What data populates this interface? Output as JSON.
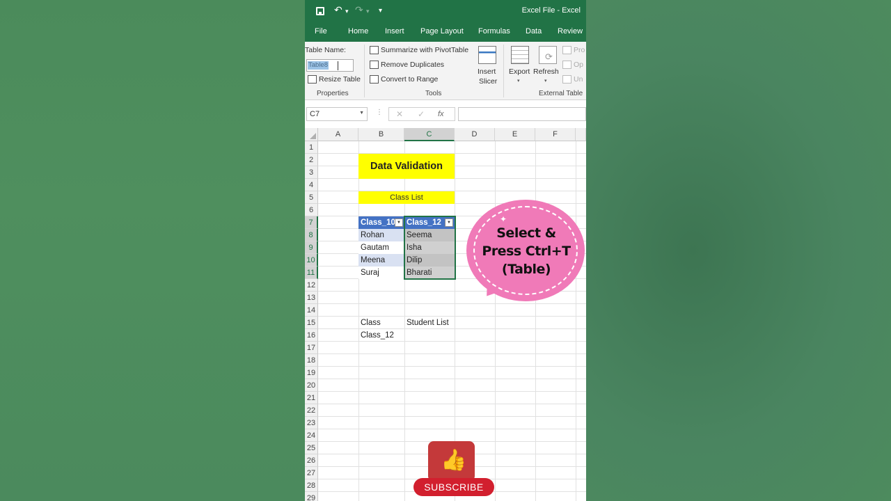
{
  "window": {
    "title": "Excel File  -  Excel"
  },
  "tabs": [
    "File",
    "Home",
    "Insert",
    "Page Layout",
    "Formulas",
    "Data",
    "Review"
  ],
  "ribbon": {
    "table_name_label": "Table Name:",
    "table_name_value": "Table8",
    "resize_table": "Resize Table",
    "properties_group": "Properties",
    "summarize_pivot": "Summarize with PivotTable",
    "remove_duplicates": "Remove Duplicates",
    "convert_to_range": "Convert to Range",
    "tools_group": "Tools",
    "insert_slicer_line1": "Insert",
    "insert_slicer_line2": "Slicer",
    "export": "Export",
    "refresh": "Refresh",
    "properties_trunc": "Pro",
    "open_trunc": "Op",
    "unlink_trunc": "Un",
    "external_group": "External Table"
  },
  "formula_bar": {
    "name_box": "C7",
    "fx": "fx",
    "cancel": "✕",
    "enter": "✓",
    "value": ""
  },
  "sheet": {
    "columns": [
      "A",
      "B",
      "C",
      "D",
      "E",
      "F"
    ],
    "selected_column": "C",
    "rows": [
      "1",
      "2",
      "3",
      "4",
      "5",
      "6",
      "7",
      "8",
      "9",
      "10",
      "11",
      "12",
      "13",
      "14",
      "15",
      "16",
      "17",
      "18",
      "19",
      "20",
      "21",
      "22",
      "23",
      "24",
      "25",
      "26",
      "27",
      "28",
      "29"
    ],
    "selected_rows": [
      "7",
      "8",
      "9",
      "10",
      "11"
    ],
    "title": "Data Validation",
    "subtitle": "Class List",
    "table": {
      "headers": [
        "Class_10",
        "Class_12"
      ],
      "class_10": [
        "Rohan",
        "Gautam",
        "Meena",
        "Suraj"
      ],
      "class_12": [
        "Seema",
        "Isha",
        "Dilip",
        "Bharati"
      ]
    },
    "b15": "Class",
    "c15": "Student List",
    "b16": "Class_12"
  },
  "callout": {
    "line1": "Select &",
    "line2": "Press Ctrl+T",
    "line3": "(Table)",
    "color": "#f07ab8"
  },
  "subscribe": {
    "label": "SUBSCRIBE",
    "color": "#d21f2e"
  },
  "accent": "#217346"
}
